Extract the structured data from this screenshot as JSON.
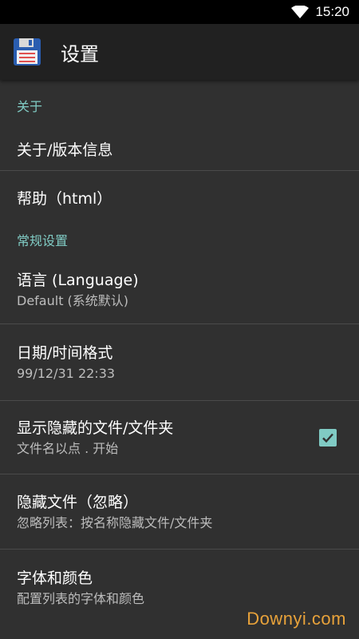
{
  "statusbar": {
    "time": "15:20",
    "wifi_icon": "wifi-icon"
  },
  "appbar": {
    "title": "设置",
    "icon": "floppy-disk-icon"
  },
  "sections": {
    "about": {
      "header": "关于"
    },
    "general": {
      "header": "常规设置"
    }
  },
  "items": {
    "about_version": {
      "primary": "关于/版本信息"
    },
    "help": {
      "primary": "帮助（html）"
    },
    "language": {
      "primary": "语言 (Language)",
      "secondary": "Default (系统默认)"
    },
    "datetime": {
      "primary": "日期/时间格式",
      "secondary": "99/12/31  22:33"
    },
    "show_hidden": {
      "primary": "显示隐藏的文件/文件夹",
      "secondary": "文件名以点 . 开始",
      "checked": true
    },
    "hide_files": {
      "primary": "隐藏文件（忽略）",
      "secondary": "忽略列表：按名称隐藏文件/文件夹"
    },
    "font_color": {
      "primary": "字体和颜色",
      "secondary": "配置列表的字体和颜色"
    }
  },
  "watermark": "Downyi.com",
  "colors": {
    "accent": "#80cbc4",
    "background": "#303030",
    "appbar": "#212121"
  }
}
